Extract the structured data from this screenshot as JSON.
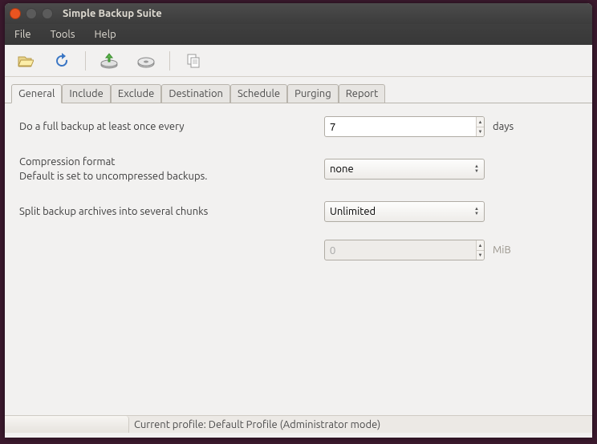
{
  "window": {
    "title": "Simple Backup Suite"
  },
  "menu": {
    "file": "File",
    "tools": "Tools",
    "help": "Help"
  },
  "tabs": {
    "general": "General",
    "include": "Include",
    "exclude": "Exclude",
    "destination": "Destination",
    "schedule": "Schedule",
    "purging": "Purging",
    "report": "Report"
  },
  "general": {
    "full_backup_label": "Do a full backup at least once every",
    "full_backup_value": "7",
    "full_backup_unit": "days",
    "compression_label": "Compression format",
    "compression_sub": "Default is set to uncompressed backups.",
    "compression_value": "none",
    "split_label": "Split backup archives into several chunks",
    "split_value": "Unlimited",
    "split_size_value": "0",
    "split_size_unit": "MiB"
  },
  "status": {
    "profile_text": "Current profile: Default Profile   (Administrator mode)"
  }
}
